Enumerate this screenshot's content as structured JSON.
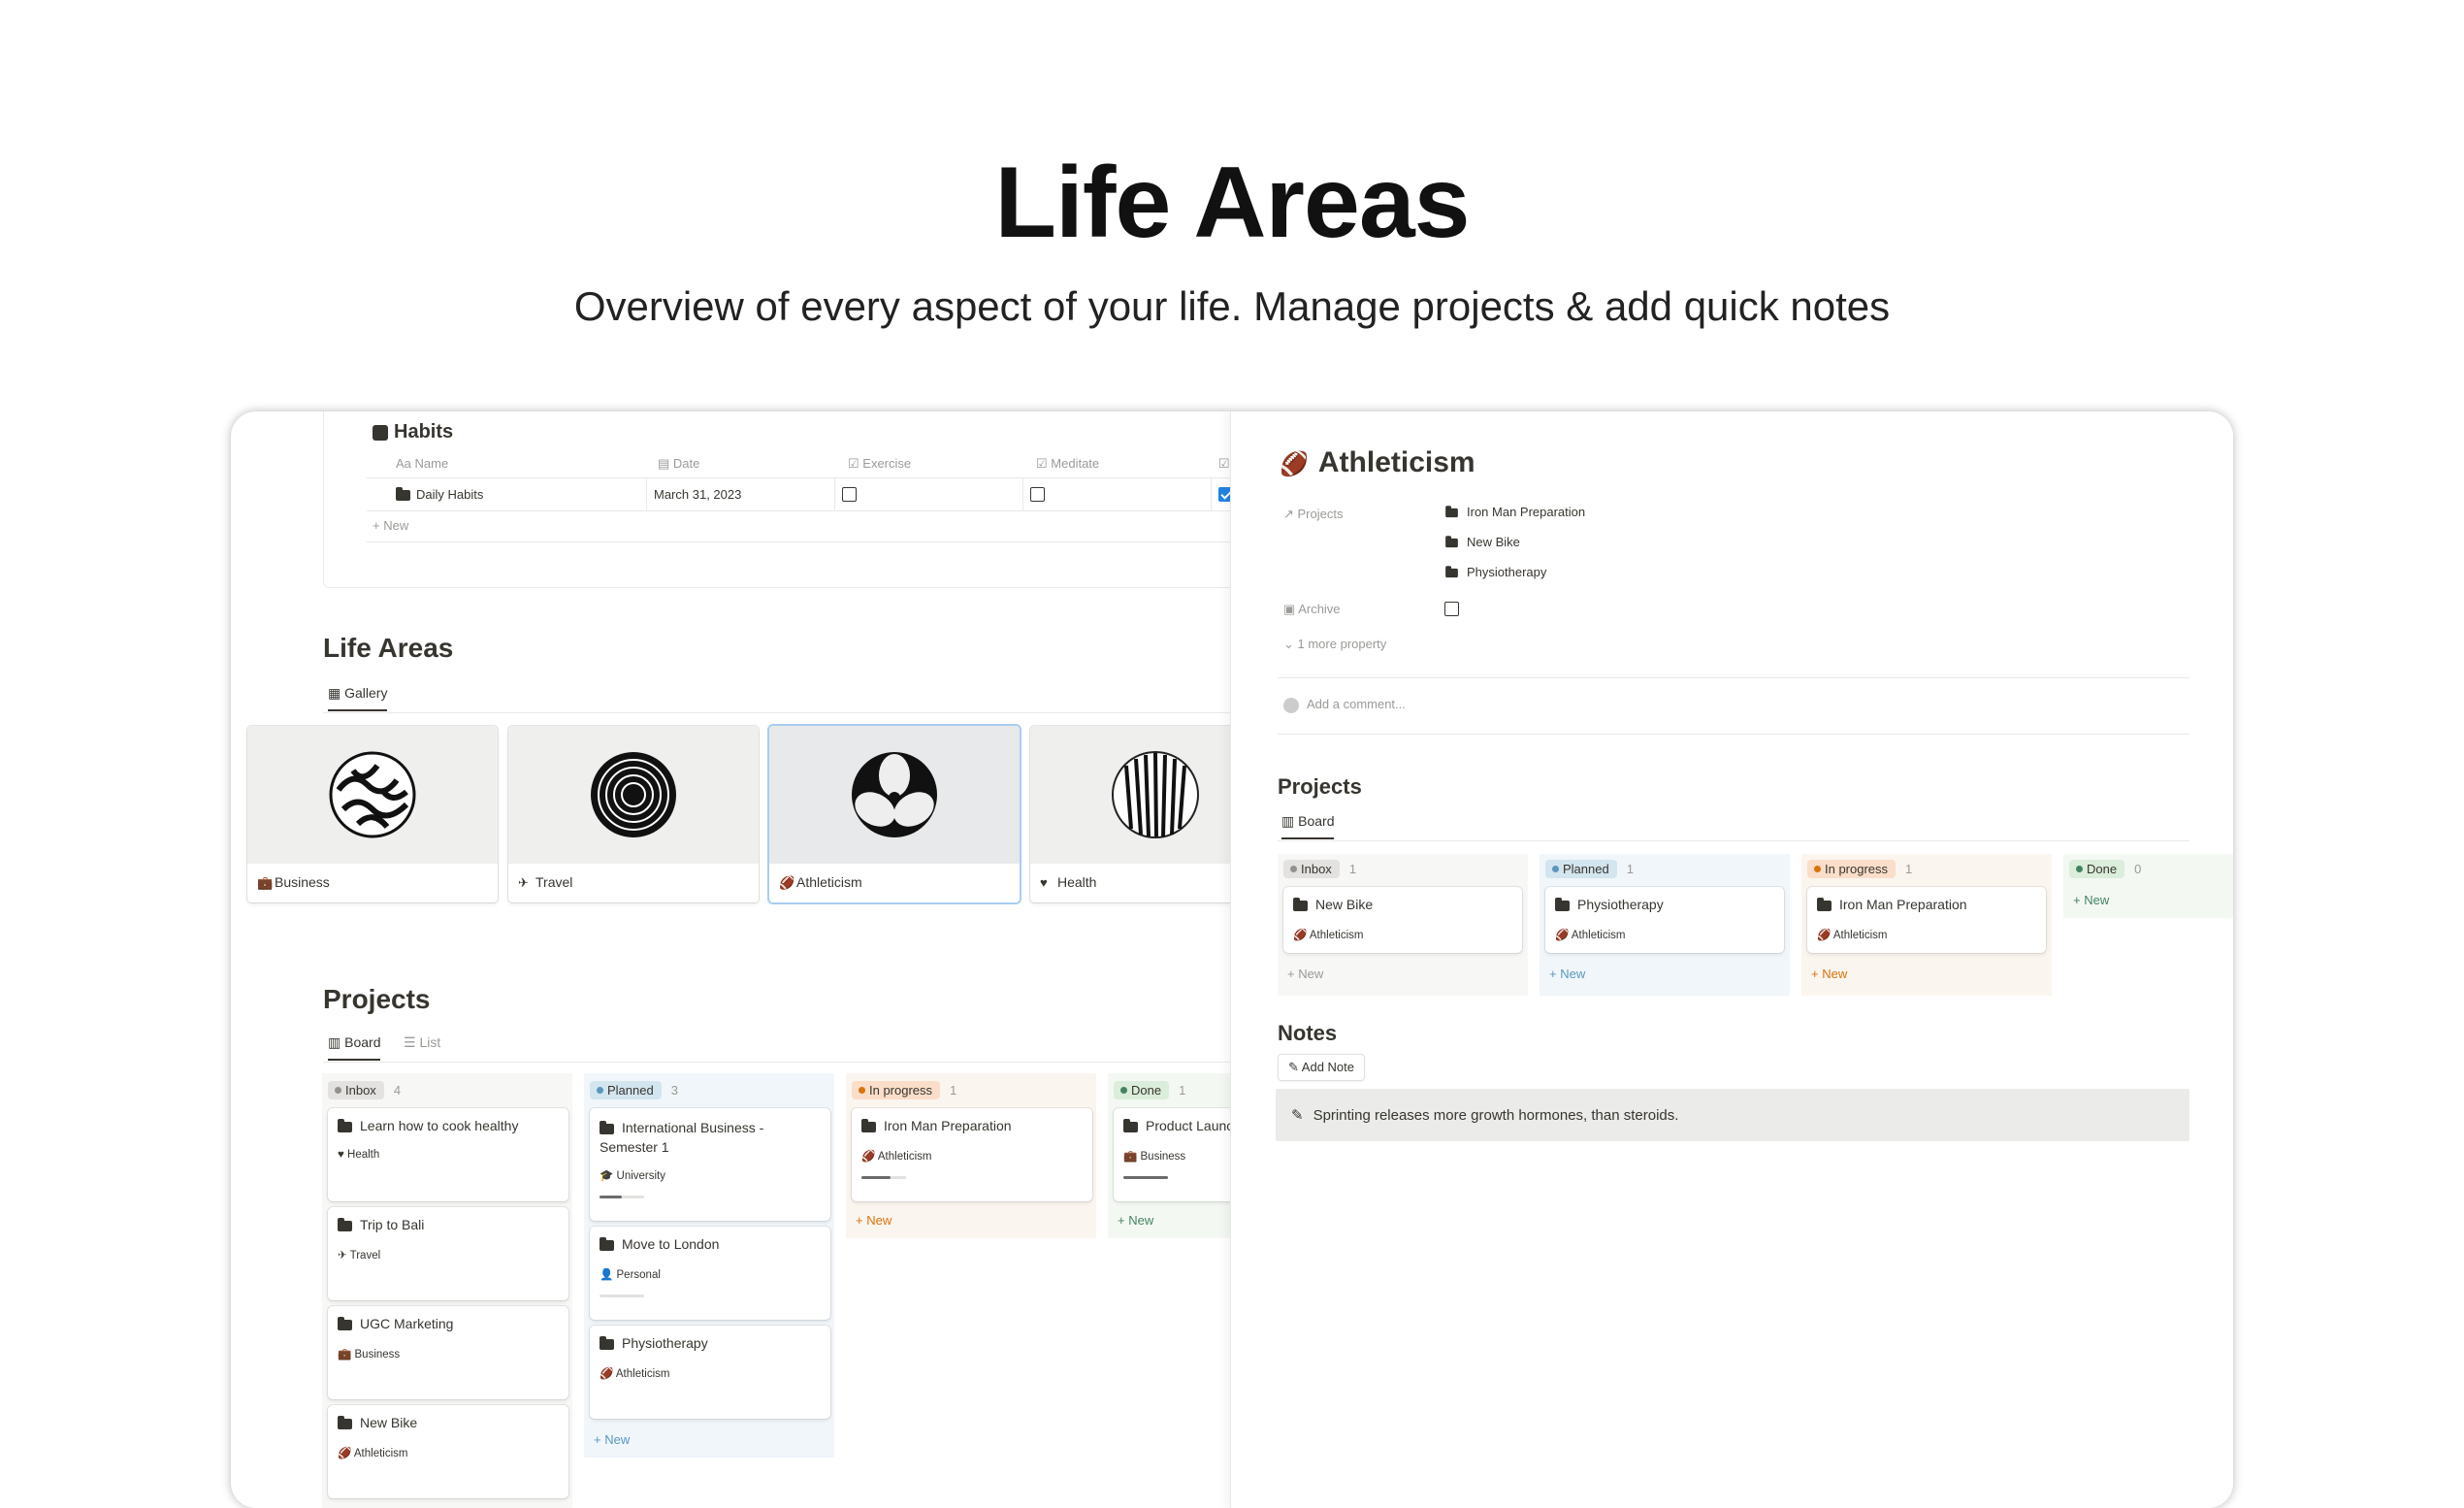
{
  "hero": {
    "title": "Life Areas",
    "subtitle": "Overview of every aspect of your life. Manage projects & add quick notes"
  },
  "habits": {
    "title": "Habits",
    "columns": [
      "Name",
      "Date",
      "Exercise",
      "Meditate"
    ],
    "row": {
      "name": "Daily Habits",
      "date": "March 31, 2023",
      "exercise": false,
      "meditate": false,
      "extra": true
    },
    "new_label": "New"
  },
  "life_areas": {
    "title": "Life Areas",
    "view_tab": "Gallery",
    "cards": [
      {
        "label": "Business",
        "icon": "briefcase-icon"
      },
      {
        "label": "Travel",
        "icon": "airplane-icon"
      },
      {
        "label": "Athleticism",
        "icon": "football-icon"
      },
      {
        "label": "Health",
        "icon": "heart-icon"
      }
    ]
  },
  "projects_left": {
    "title": "Projects",
    "tabs": [
      "Board",
      "List"
    ],
    "columns": [
      {
        "status": "Inbox",
        "count": "4",
        "cards": [
          {
            "title": "Learn how to cook healthy",
            "area": "Health"
          },
          {
            "title": "Trip to Bali",
            "area": "Travel"
          },
          {
            "title": "UGC Marketing",
            "area": "Business"
          },
          {
            "title": "New Bike",
            "area": "Athleticism"
          }
        ]
      },
      {
        "status": "Planned",
        "count": "3",
        "cards": [
          {
            "title": "International Business - Semester 1",
            "area": "University",
            "progress": 0.3
          },
          {
            "title": "Move to London",
            "area": "Personal",
            "progress": 0
          },
          {
            "title": "Physiotherapy",
            "area": "Athleticism"
          }
        ],
        "new_label": "New"
      },
      {
        "status": "In progress",
        "count": "1",
        "cards": [
          {
            "title": "Iron Man Preparation",
            "area": "Athleticism",
            "progress": 0.6
          }
        ],
        "new_label": "New"
      },
      {
        "status": "Done",
        "count": "1",
        "cards": [
          {
            "title": "Product Launch",
            "area": "Business",
            "progress": 1
          }
        ],
        "new_label": "New"
      }
    ]
  },
  "detail": {
    "title": "Athleticism",
    "props": {
      "projects_label": "Projects",
      "projects": [
        "Iron Man Preparation",
        "New Bike",
        "Physiotherapy"
      ],
      "archive_label": "Archive",
      "more": "1 more property"
    },
    "comment_placeholder": "Add a comment...",
    "projects_title": "Projects",
    "board_tab": "Board",
    "columns": [
      {
        "status": "Inbox",
        "count": "1",
        "card": {
          "title": "New Bike",
          "area": "Athleticism"
        },
        "new_label": "New"
      },
      {
        "status": "Planned",
        "count": "1",
        "card": {
          "title": "Physiotherapy",
          "area": "Athleticism"
        },
        "new_label": "New"
      },
      {
        "status": "In progress",
        "count": "1",
        "card": {
          "title": "Iron Man Preparation",
          "area": "Athleticism"
        },
        "new_label": "New"
      },
      {
        "status": "Done",
        "count": "0",
        "new_label": "New"
      }
    ],
    "notes_title": "Notes",
    "add_note": "Add Note",
    "note": "Sprinting releases more growth hormones, than steroids."
  },
  "colors": {
    "blue_check": "#2383e2",
    "inbox": "#e3e2e0",
    "planned": "#d3e5ef",
    "in_progress": "#fadec9",
    "done": "#dbeddb"
  }
}
